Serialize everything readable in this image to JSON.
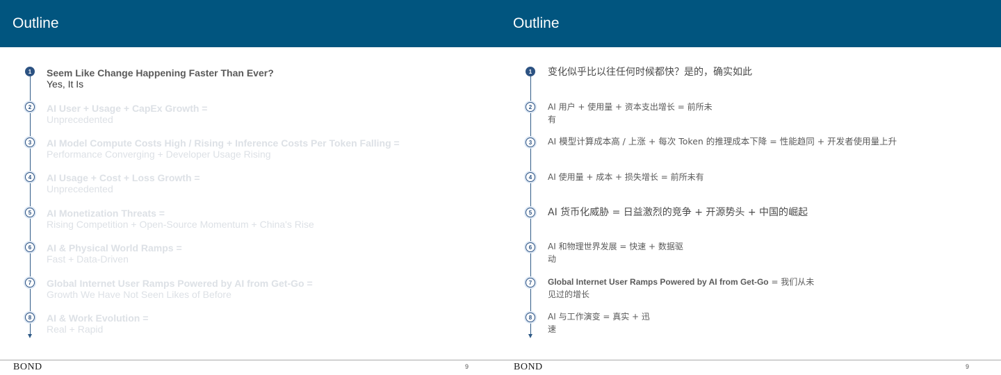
{
  "left": {
    "title": "Outline",
    "items": [
      {
        "n": "1",
        "h": "Seem Like Change Happening Faster Than Ever?",
        "s": "Yes, It Is"
      },
      {
        "n": "2",
        "h": "AI User + Usage + CapEx Growth =",
        "s": "Unprecedented"
      },
      {
        "n": "3",
        "h": "AI Model Compute Costs High / Rising + Inference Costs Per Token Falling =",
        "s": "Performance Converging + Developer Usage Rising"
      },
      {
        "n": "4",
        "h": "AI Usage + Cost + Loss Growth =",
        "s": "Unprecedented"
      },
      {
        "n": "5",
        "h": "AI Monetization Threats =",
        "s": "Rising Competition + Open-Source Momentum + China's Rise"
      },
      {
        "n": "6",
        "h": "AI & Physical World Ramps =",
        "s": "Fast + Data-Driven"
      },
      {
        "n": "7",
        "h": "Global Internet User Ramps Powered by AI from Get-Go =",
        "s": "Growth We Have Not Seen Likes of Before"
      },
      {
        "n": "8",
        "h": "AI & Work Evolution =",
        "s": "Real + Rapid"
      }
    ],
    "footer": {
      "brand": "BOND",
      "page": "9"
    }
  },
  "right": {
    "title": "Outline",
    "items": [
      {
        "n": "1",
        "l1": "变化似乎比以往任何时候都快？是的，确实如此",
        "l2": ""
      },
      {
        "n": "2",
        "l1": "AI 用户 + 使用量 + 资本支出增长 = 前所未",
        "l2": "有"
      },
      {
        "n": "3",
        "l1": "AI 模型计算成本高 / 上涨 + 每次 Token 的推理成本下降 = 性能趋同 + 开发者使用量上升",
        "l2": ""
      },
      {
        "n": "4",
        "l1": "AI 使用量 + 成本 + 损失增长 = 前所未有",
        "l2": ""
      },
      {
        "n": "5",
        "l1": "AI 货币化威胁 = 日益激烈的竞争 + 开源势头 + 中国的崛起",
        "l2": ""
      },
      {
        "n": "6",
        "l1": "AI 和物理世界发展 = 快速 + 数据驱",
        "l2": "动"
      },
      {
        "n": "7",
        "l1bold": "Global Internet User Ramps Powered by AI from Get-Go",
        "l1rest": " = 我们从未",
        "l2": "见过的增长"
      },
      {
        "n": "8",
        "l1": "AI 与工作演变 = 真实 + 迅",
        "l2": "速"
      }
    ],
    "footer": {
      "brand": "BOND",
      "page": "9"
    }
  }
}
